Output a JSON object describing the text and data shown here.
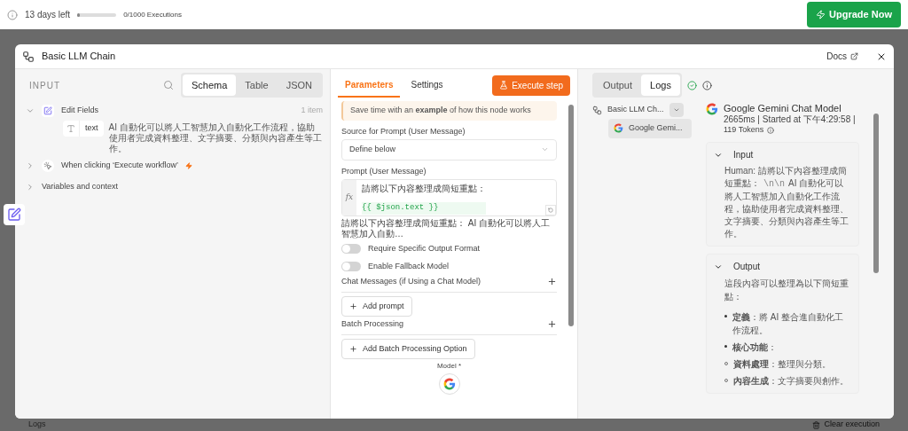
{
  "top_bar": {
    "trial": "13 days left",
    "usage": {
      "level": 0.02,
      "label": "0/1000 Executions"
    },
    "upgrade": "Upgrade Now"
  },
  "modal": {
    "title": "Basic LLM Chain",
    "docs": "Docs"
  },
  "input_panel": {
    "title": "INPUT",
    "tabs": [
      {
        "label": "Schema",
        "selected": true
      },
      {
        "label": "Table",
        "selected": false
      },
      {
        "label": "JSON",
        "selected": false
      }
    ],
    "nodes": [
      {
        "name": "Edit Fields",
        "count": "1 item",
        "expanded": true,
        "fields": [
          {
            "name": "text",
            "value": "AI 自動化可以將人工智慧加入自動化工作流程，協助使用者完成資料整理、文字摘要、分類與內容產生等工作。"
          }
        ]
      },
      {
        "name": "When clicking ‘Execute workflow’",
        "expanded": false
      }
    ],
    "variables": "Variables and context"
  },
  "parameters_panel": {
    "tabs": [
      {
        "label": "Parameters",
        "selected": true
      },
      {
        "label": "Settings",
        "selected": false
      }
    ],
    "execute": "Execute step",
    "hint": "Save time with an **example** of how this node works",
    "source_label": "Source for Prompt (User Message)",
    "source_value": "Define below",
    "prompt_label": "Prompt (User Message)",
    "prompt_prefix": "fx",
    "prompt_line": "請將以下內容整理成簡短重點：",
    "prompt_expr": "{{ $json.text }}",
    "prompt_preview": "請將以下內容整理成簡短重點： AI 自動化可以將人工智慧加入自動…",
    "toggles": [
      {
        "label": "Require Specific Output Format",
        "on": false
      },
      {
        "label": "Enable Fallback Model",
        "on": false
      }
    ],
    "sections": [
      {
        "label": "Chat Messages (if Using a Chat Model)",
        "button": "Add prompt"
      },
      {
        "label": "Batch Processing",
        "button": "Add Batch Processing Option"
      }
    ],
    "model_label": "Model *"
  },
  "output_panel": {
    "tabs": [
      {
        "label": "Output",
        "selected": false
      },
      {
        "label": "Logs",
        "selected": true
      }
    ],
    "tree": [
      {
        "name": "Basic LLM Ch...",
        "children": [
          {
            "name": "Google Gemi..."
          }
        ]
      }
    ],
    "detail": {
      "title": "Google Gemini Chat Model",
      "meta": "2665ms | Started at 下午4:29:58 |",
      "tokens": "119 Tokens",
      "input": {
        "title": "Input",
        "prefix": "Human: 請將以下內容整理成簡短重點：",
        "escaped": "\\n\\n",
        "rest": "AI 自動化可以將人工智慧加入自動化工作流程，協助使用者完成資料整理、文字摘要、分類與內容產生等工作。"
      },
      "output": {
        "title": "Output",
        "intro": "這段內容可以整理為以下簡短重點：",
        "bullets": [
          {
            "text": "**定義**：將 AI 整合進自動化工作流程。"
          },
          {
            "text": "**核心功能**：",
            "children": [
              {
                "text": "**資料處理**：整理與分類。"
              },
              {
                "text": "**內容生成**：文字摘要與創作。"
              }
            ]
          }
        ]
      }
    }
  },
  "bottom_bar": {
    "logs": "Logs",
    "clear": "Clear execution"
  }
}
